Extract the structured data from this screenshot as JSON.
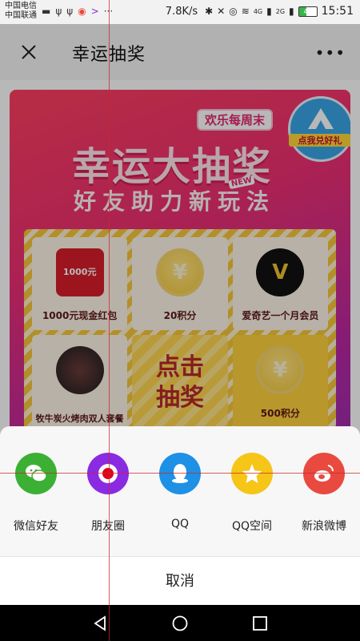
{
  "status_bar": {
    "carrier_1": "中国电信",
    "carrier_2": "中国联通",
    "net_speed": "7.8K/s",
    "battery": "40",
    "time": "15:51",
    "signal_1": "4G",
    "signal_2": "2G"
  },
  "header": {
    "title": "幸运抽奖",
    "more": "•••"
  },
  "banner": {
    "weekend_tag": "欢乐每周末",
    "big_title": "幸运大抽奖",
    "subtitle": "好友助力新玩法",
    "new_tag": "NEW",
    "redeem_label": "点我兑好礼"
  },
  "prizes": [
    {
      "label": "1000元现金红包",
      "icon_text": "1000元"
    },
    {
      "label": "20积分",
      "icon_text": "¥"
    },
    {
      "label": "爱奇艺一个月会员",
      "icon_text": "V"
    },
    {
      "label": "牧牛炭火烤肉双人套餐",
      "icon_text": ""
    },
    {
      "label": "",
      "icon_text": "点击抽奖"
    },
    {
      "label": "500积分",
      "icon_text": "¥"
    }
  ],
  "share": {
    "items": [
      {
        "label": "微信好友",
        "color": "#3cb034"
      },
      {
        "label": "朋友圈",
        "color": "#8a2be2"
      },
      {
        "label": "QQ",
        "color": "#1e90e6"
      },
      {
        "label": "QQ空间",
        "color": "#f5c518"
      },
      {
        "label": "新浪微博",
        "color": "#e94a3f"
      }
    ],
    "cancel": "取消"
  }
}
